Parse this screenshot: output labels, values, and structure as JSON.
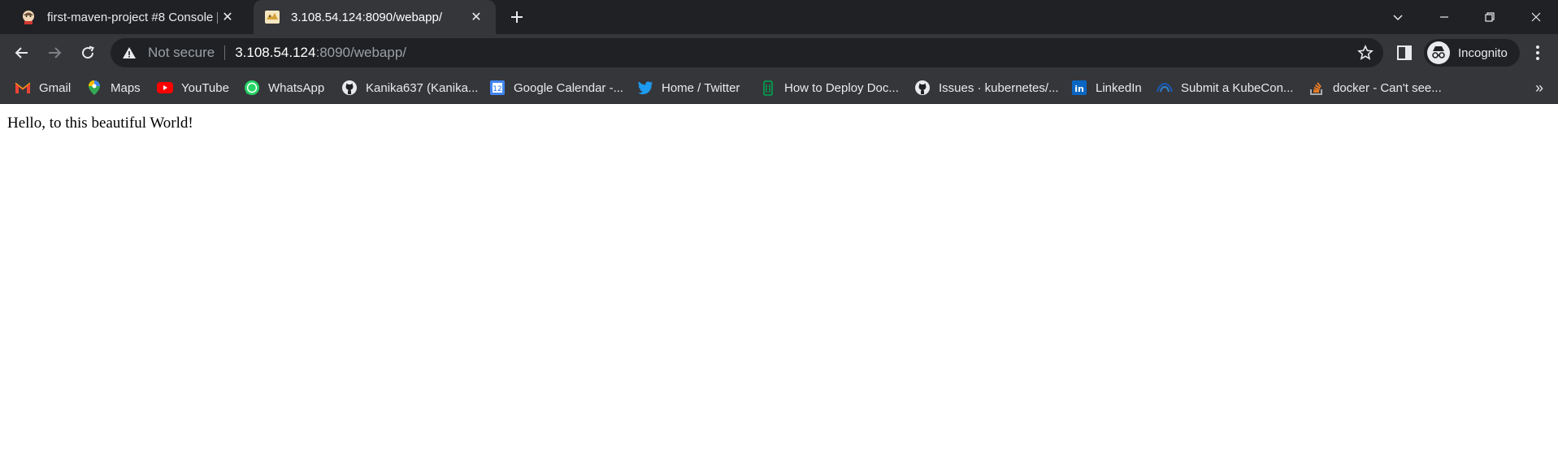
{
  "tabs": [
    {
      "title": "first-maven-project #8 Console [J",
      "active": false
    },
    {
      "title": "3.108.54.124:8090/webapp/",
      "active": true
    }
  ],
  "toolbar": {
    "security_label": "Not secure",
    "url_host": "3.108.54.124",
    "url_rest": ":8090/webapp/",
    "profile_label": "Incognito"
  },
  "bookmarks": [
    {
      "label": "Gmail",
      "icon": "gmail-icon"
    },
    {
      "label": "Maps",
      "icon": "maps-icon"
    },
    {
      "label": "YouTube",
      "icon": "youtube-icon"
    },
    {
      "label": "WhatsApp",
      "icon": "whatsapp-icon"
    },
    {
      "label": "Kanika637 (Kanika...",
      "icon": "github-icon"
    },
    {
      "label": "Google Calendar -...",
      "icon": "calendar-icon"
    },
    {
      "label": "Home / Twitter",
      "icon": "twitter-icon"
    },
    {
      "label": "How to Deploy Doc...",
      "icon": "docs-icon"
    },
    {
      "label": "Issues · kubernetes/...",
      "icon": "github-icon"
    },
    {
      "label": "LinkedIn",
      "icon": "linkedin-icon"
    },
    {
      "label": "Submit a KubeCon...",
      "icon": "kubecon-icon"
    },
    {
      "label": "docker - Can't see...",
      "icon": "stackoverflow-icon"
    }
  ],
  "page": {
    "message": "Hello, to this beautiful World!"
  },
  "colors": {
    "tabstrip": "#202124",
    "toolbar": "#35363a",
    "text": "#e8eaed",
    "page_bg": "#ffffff"
  }
}
